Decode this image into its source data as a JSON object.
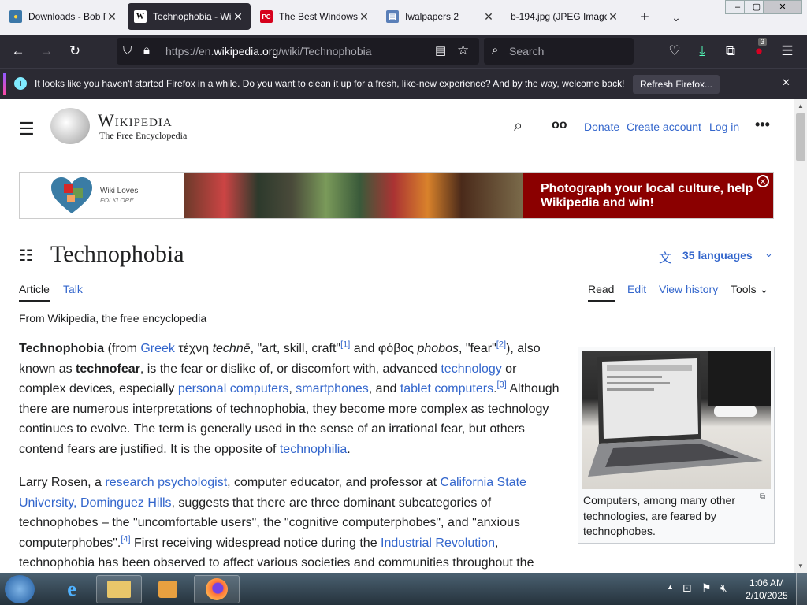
{
  "tabs": [
    {
      "title": "Downloads - Bob P",
      "favicon": "python"
    },
    {
      "title": "Technophobia - Wi",
      "favicon": "W",
      "active": true
    },
    {
      "title": "The Best Windows",
      "favicon": "PC"
    },
    {
      "title": "Iwalpapers 2",
      "favicon": "iw"
    },
    {
      "title": "b-194.jpg (JPEG Image,",
      "favicon": "img"
    }
  ],
  "nav": {
    "url_prefix": "https://en.",
    "url_domain": "wikipedia.org",
    "url_path": "/wiki/Technophobia",
    "search_placeholder": "Search",
    "extensions_badge": "3"
  },
  "notification": {
    "message": "It looks like you haven't started Firefox in a while. Do you want to clean it up for a fresh, like-new experience? And by the way, welcome back!",
    "button": "Refresh Firefox..."
  },
  "wiki": {
    "logo_name": "Wikipedia",
    "logo_tagline": "The Free Encyclopedia",
    "header_links": {
      "donate": "Donate",
      "create_account": "Create account",
      "login": "Log in"
    },
    "banner": {
      "logo_line1": "Wiki Loves",
      "logo_line2": "FOLKLORE",
      "text": "Photograph your local culture, help Wikipedia and win!"
    },
    "title": "Technophobia",
    "languages": "35 languages",
    "tabs_left": [
      "Article",
      "Talk"
    ],
    "tabs_right": [
      "Read",
      "Edit",
      "View history",
      "Tools"
    ],
    "from": "From Wikipedia, the free encyclopedia",
    "p1": {
      "t1": "Technophobia",
      "t2": " (from ",
      "l_greek": "Greek",
      "t3": " τέχνη ",
      "t4": "technē",
      "t5": ", \"art, skill, craft\"",
      "r1": "[1]",
      "t6": " and φόβος ",
      "t7": "phobos",
      "t8": ", \"fear\"",
      "r2": "[2]",
      "t9": "), also known as ",
      "t10": "technofear",
      "t11": ", is the fear or dislike of, or discomfort with, advanced ",
      "l_technology": "technology",
      "t12": " or complex devices, especially ",
      "l_pc": "personal computers",
      "t13": ", ",
      "l_sp": "smartphones",
      "t14": ", and ",
      "l_tablet": "tablet computers",
      "t15": ".",
      "r3": "[3]",
      "t16": " Although there are numerous interpretations of technophobia, they become more complex as technology continues to evolve. The term is generally used in the sense of an irrational fear, but others contend fears are justified. It is the opposite of ",
      "l_philia": "technophilia",
      "t17": "."
    },
    "p2": {
      "t1": "Larry Rosen, a ",
      "l_rp": "research psychologist",
      "t2": ", computer educator, and professor at ",
      "l_csu": "California State University, Dominguez Hills",
      "t3": ", suggests that there are three dominant subcategories of technophobes – the \"uncomfortable users\", the \"cognitive computerphobes\", and \"anxious computerphobes\".",
      "r4": "[4]",
      "t4": " First receiving widespread notice during the ",
      "l_ir": "Industrial Revolution",
      "t5": ", technophobia has been observed to affect various societies and communities throughout the"
    },
    "infobox_caption": "Computers, among many other technologies, are feared by technophobes."
  },
  "taskbar": {
    "time": "1:06 AM",
    "date": "2/10/2025"
  },
  "colors": {
    "tab_bg": "#f0f0f4",
    "toolbar": "#2b2a33",
    "link": "#3366cc",
    "banner_red": "#8b0000"
  }
}
